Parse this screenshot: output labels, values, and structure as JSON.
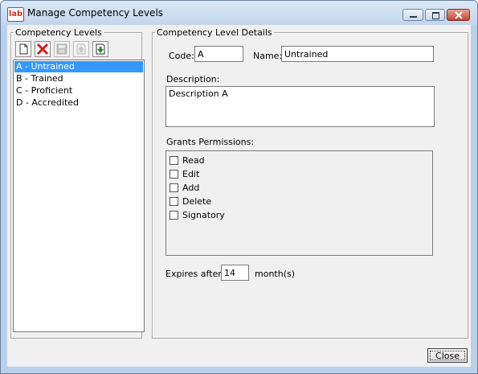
{
  "window": {
    "app_icon_text": "lab",
    "title": "Manage Competency Levels"
  },
  "left_panel": {
    "legend": "Competency Levels",
    "toolbar": [
      {
        "icon": "new-document-icon",
        "enabled": true
      },
      {
        "icon": "delete-x-icon",
        "enabled": true
      },
      {
        "icon": "save-disk-icon",
        "enabled": false
      },
      {
        "icon": "move-up-icon",
        "enabled": false
      },
      {
        "icon": "move-down-icon",
        "enabled": true
      }
    ],
    "items": [
      {
        "label": "A - Untrained",
        "selected": true
      },
      {
        "label": "B - Trained",
        "selected": false
      },
      {
        "label": "C - Proficient",
        "selected": false
      },
      {
        "label": "D - Accredited",
        "selected": false
      }
    ]
  },
  "details": {
    "legend": "Competency Level Details",
    "code_label": "Code:",
    "code_value": "A",
    "name_label": "Name:",
    "name_value": "Untrained",
    "description_label": "Description:",
    "description_value": "Description A",
    "permissions_label": "Grants Permissions:",
    "permissions": [
      {
        "label": "Read",
        "checked": false
      },
      {
        "label": "Edit",
        "checked": false
      },
      {
        "label": "Add",
        "checked": false
      },
      {
        "label": "Delete",
        "checked": false
      },
      {
        "label": "Signatory",
        "checked": false
      }
    ],
    "expires_label": "Expires after",
    "expires_value": "14",
    "expires_unit": "month(s)"
  },
  "footer": {
    "close_label": "Close"
  },
  "colors": {
    "selection": "#3399ff",
    "title_close": "#c4452f",
    "window_frame": "#b9d1ea"
  }
}
